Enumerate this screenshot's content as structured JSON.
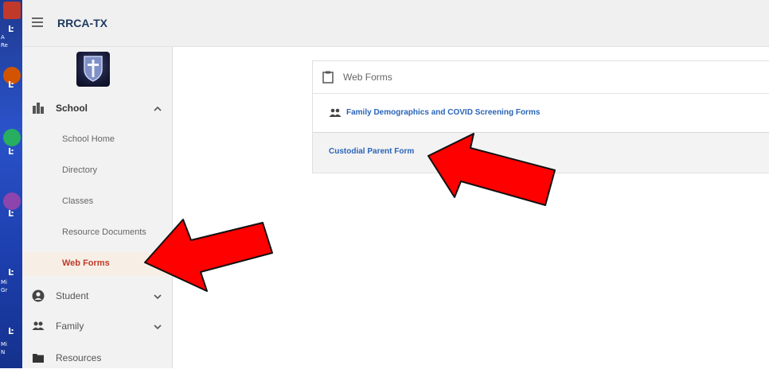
{
  "app": {
    "title": "RRCA-TX"
  },
  "sidebar": {
    "school": {
      "label": "School",
      "icon": "building-icon"
    },
    "school_items": [
      {
        "label": "School Home"
      },
      {
        "label": "Directory"
      },
      {
        "label": "Classes"
      },
      {
        "label": "Resource Documents"
      },
      {
        "label": "Web Forms",
        "active": true
      }
    ],
    "student": {
      "label": "Student",
      "icon": "person-icon"
    },
    "family": {
      "label": "Family",
      "icon": "people-icon"
    },
    "resources": {
      "label": "Resources",
      "icon": "folder-icon"
    }
  },
  "web_forms": {
    "title": "Web Forms",
    "forms": [
      {
        "label": "Family Demographics and COVID Screening Forms",
        "icon": "people-icon"
      },
      {
        "label": "Custodial Parent Form"
      }
    ]
  },
  "desktop": {
    "labels": [
      "A",
      "Re",
      "Mi",
      "Gr",
      "Mi",
      "N"
    ]
  },
  "colors": {
    "accent_link": "#2b64b8",
    "active_nav": "#c0392b",
    "annotation_arrow": "#ff0000"
  }
}
